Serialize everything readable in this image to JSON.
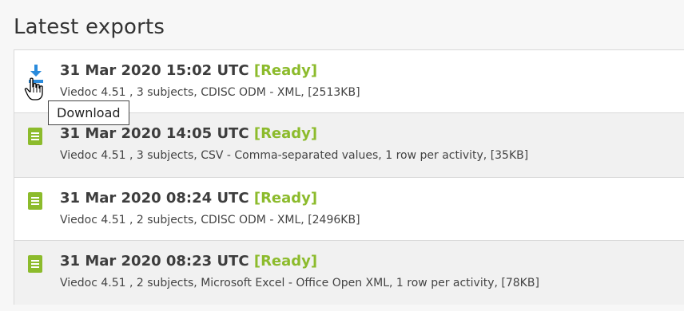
{
  "heading": "Latest exports",
  "tooltip": "Download",
  "colors": {
    "ready": "#8cbb2c",
    "download_icon": "#2a8bdc",
    "file_icon": "#8cbb2c"
  },
  "exports": [
    {
      "datetime": "31 Mar 2020 15:02 UTC",
      "status": "[Ready]",
      "details": "Viedoc 4.51 , 3 subjects, CDISC ODM - XML, [2513KB]",
      "icon": "download-icon"
    },
    {
      "datetime": "31 Mar 2020 14:05 UTC",
      "status": "[Ready]",
      "details": "Viedoc 4.51 , 3 subjects, CSV - Comma-separated values, 1 row per activity, [35KB]",
      "icon": "file-icon"
    },
    {
      "datetime": "31 Mar 2020 08:24 UTC",
      "status": "[Ready]",
      "details": "Viedoc 4.51 , 2 subjects, CDISC ODM - XML, [2496KB]",
      "icon": "file-icon"
    },
    {
      "datetime": "31 Mar 2020 08:23 UTC",
      "status": "[Ready]",
      "details": "Viedoc 4.51 , 2 subjects, Microsoft Excel - Office Open XML, 1 row per activity, [78KB]",
      "icon": "file-icon"
    }
  ]
}
